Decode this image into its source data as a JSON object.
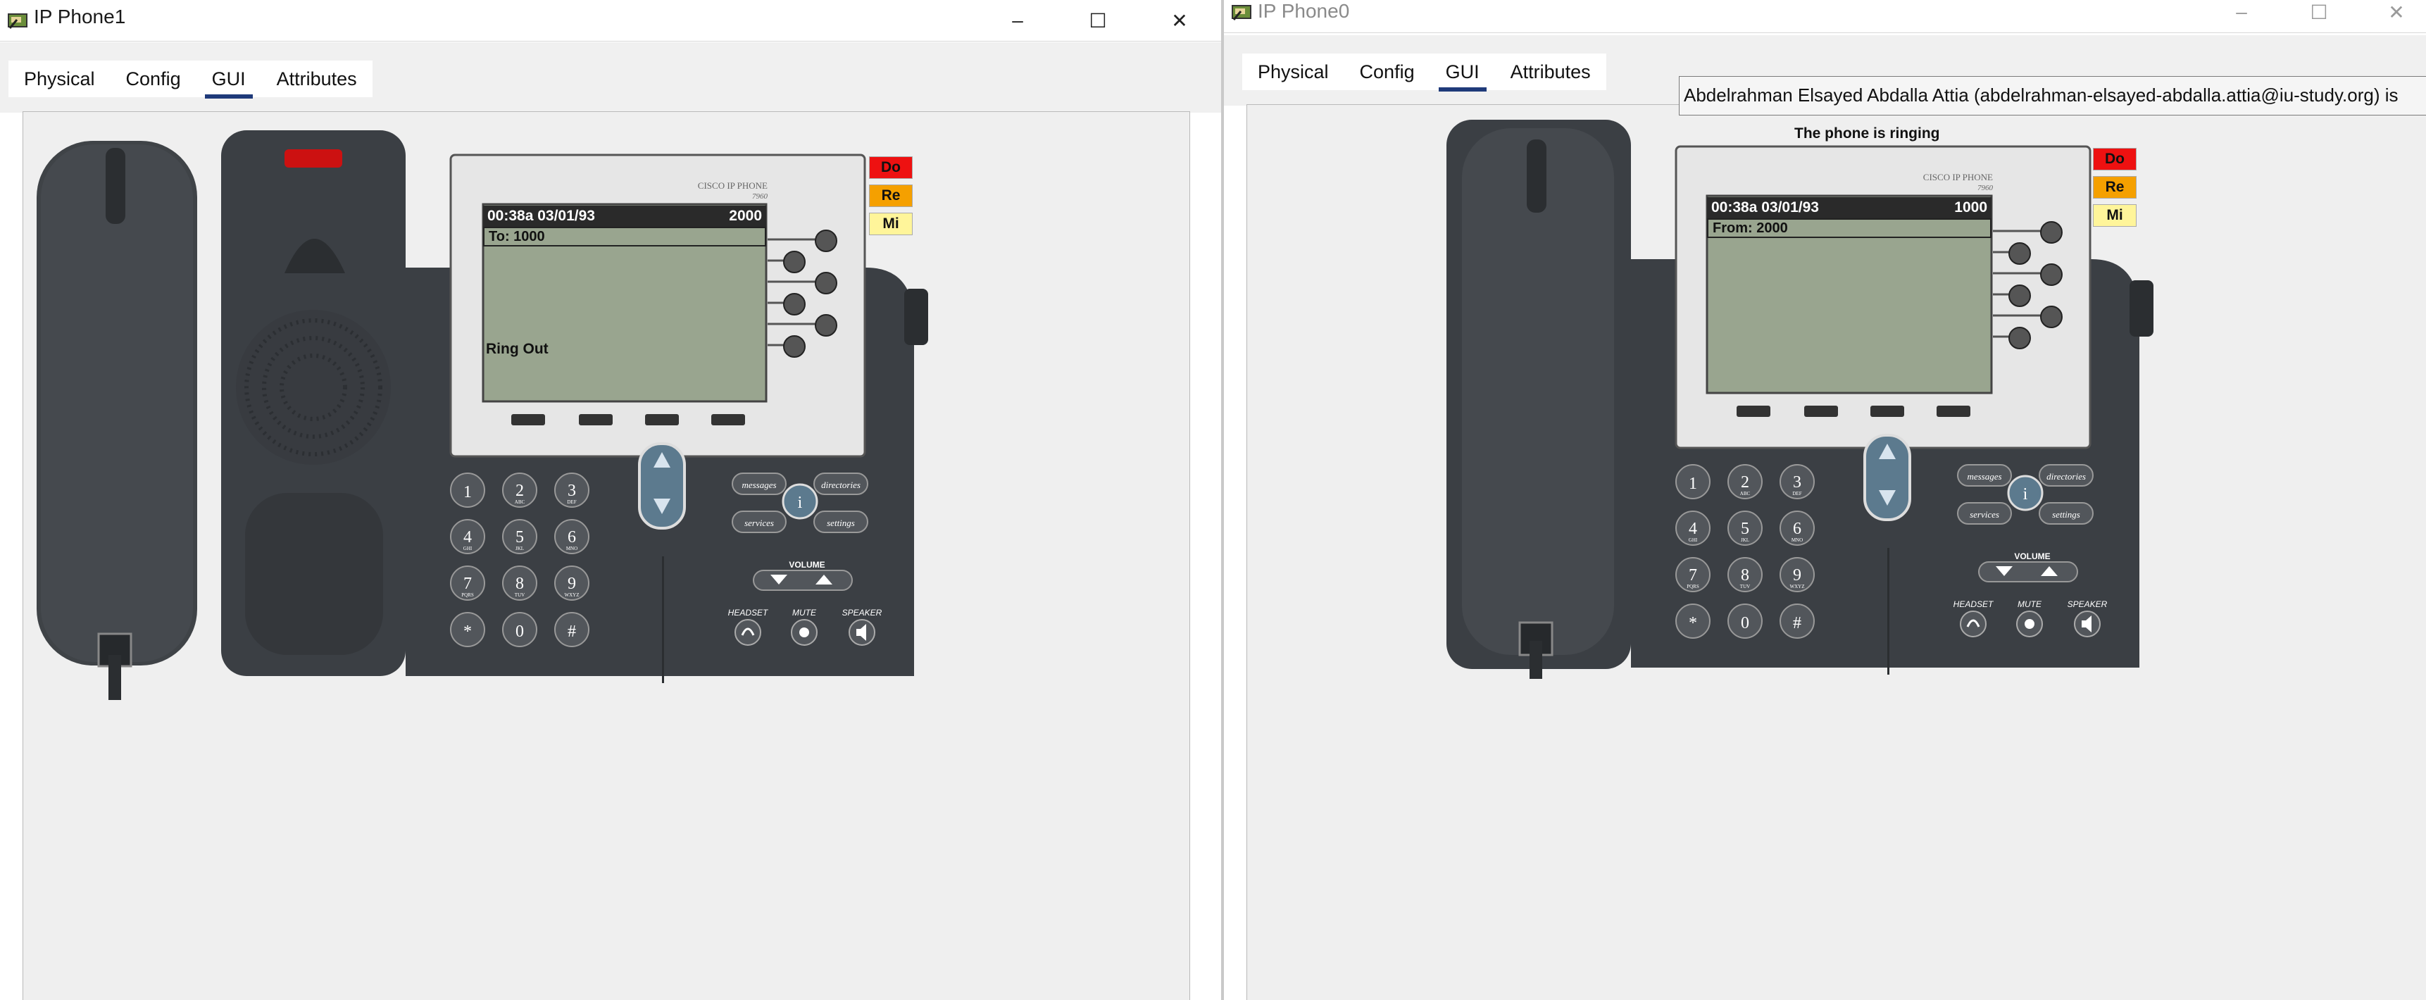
{
  "left_window": {
    "title": "IP Phone1",
    "tabs": [
      "Physical",
      "Config",
      "GUI",
      "Attributes"
    ],
    "active_tab": "GUI",
    "phone": {
      "brand_line1": "CISCO IP PHONE",
      "brand_line2": "7960",
      "lcd_time": "00:38a 03/01/93",
      "lcd_extension": "2000",
      "lcd_line2": "To: 1000",
      "lcd_status": "Ring Out",
      "side_buttons": [
        "Do",
        "Re",
        "Mi"
      ]
    }
  },
  "right_window": {
    "title": "IP Phone0",
    "tabs": [
      "Physical",
      "Config",
      "GUI",
      "Attributes"
    ],
    "active_tab": "GUI",
    "ringing_label": "The phone is ringing",
    "phone": {
      "brand_line1": "CISCO IP PHONE",
      "brand_line2": "7960",
      "lcd_time": "00:38a 03/01/93",
      "lcd_extension": "1000",
      "lcd_line2": "From: 2000",
      "lcd_status": "",
      "side_buttons": [
        "Do",
        "Re",
        "Mi"
      ]
    }
  },
  "tooltip": "Abdelrahman Elsayed Abdalla Attia (abdelrahman-elsayed-abdalla.attia@iu-study.org) is",
  "keypad": {
    "keys": [
      {
        "digit": "1",
        "letters": ""
      },
      {
        "digit": "2",
        "letters": "ABC"
      },
      {
        "digit": "3",
        "letters": "DEF"
      },
      {
        "digit": "4",
        "letters": "GHI"
      },
      {
        "digit": "5",
        "letters": "JKL"
      },
      {
        "digit": "6",
        "letters": "MNO"
      },
      {
        "digit": "7",
        "letters": "PQRS"
      },
      {
        "digit": "8",
        "letters": "TUV"
      },
      {
        "digit": "9",
        "letters": "WXYZ"
      },
      {
        "digit": "*",
        "letters": ""
      },
      {
        "digit": "0",
        "letters": ""
      },
      {
        "digit": "#",
        "letters": ""
      }
    ],
    "func_buttons": [
      "messages",
      "directories",
      "services",
      "settings"
    ],
    "info": "i",
    "volume_label": "VOLUME",
    "bottom_labels": [
      "HEADSET",
      "MUTE",
      "SPEAKER"
    ]
  },
  "colors": {
    "accent_tab": "#1f3a7a",
    "do_button": "#ee1111",
    "re_button": "#f5a000",
    "mi_button": "#fff59a",
    "lcd_bg": "#99a58f",
    "phone_body": "#3b3f44"
  },
  "window_controls": [
    "minimize-icon",
    "maximize-icon",
    "close-icon"
  ]
}
